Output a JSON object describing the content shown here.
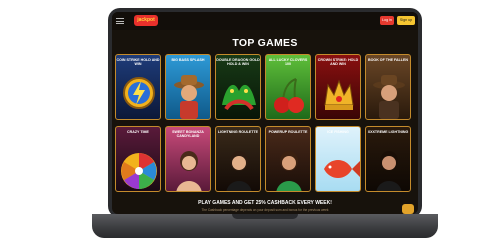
{
  "header": {
    "logo_text": "jackpot",
    "login_label": "Log in",
    "signup_label": "Sign up"
  },
  "section": {
    "title": "TOP GAMES"
  },
  "games_row1": [
    {
      "title": "COIN STRIKE HOLD AND WIN",
      "icon": "lightning-coin-icon"
    },
    {
      "title": "BIG BASS SPLASH",
      "icon": "fisherman-icon"
    },
    {
      "title": "DOUBLE DRAGON GOLD HOLD & WIN",
      "icon": "dragon-icon"
    },
    {
      "title": "ALL LUCKY CLOVERS 100",
      "icon": "cherries-icon"
    },
    {
      "title": "CROWN STRIKE: HOLD AND WIN",
      "icon": "crown-icon"
    },
    {
      "title": "BOOK OF THE FALLEN",
      "icon": "explorer-icon"
    }
  ],
  "games_row2": [
    {
      "title": "CRAZY TIME",
      "icon": "wheel-icon"
    },
    {
      "title": "SWEET BONANZA CANDYLAND",
      "icon": "host-icon"
    },
    {
      "title": "LIGHTNING ROULETTE",
      "icon": "host-icon"
    },
    {
      "title": "POWERUP ROULETTE",
      "icon": "host-icon"
    },
    {
      "title": "ICE FISHING",
      "icon": "fish-icon"
    },
    {
      "title": "XXXTREME LIGHTNING",
      "icon": "host-icon"
    }
  ],
  "promo": {
    "headline": "PLAY GAMES AND GET 25% CASHBACK EVERY WEEK!",
    "subtext": "The Cashback percentage depends on your deposit sum and bonus for the previous week"
  }
}
